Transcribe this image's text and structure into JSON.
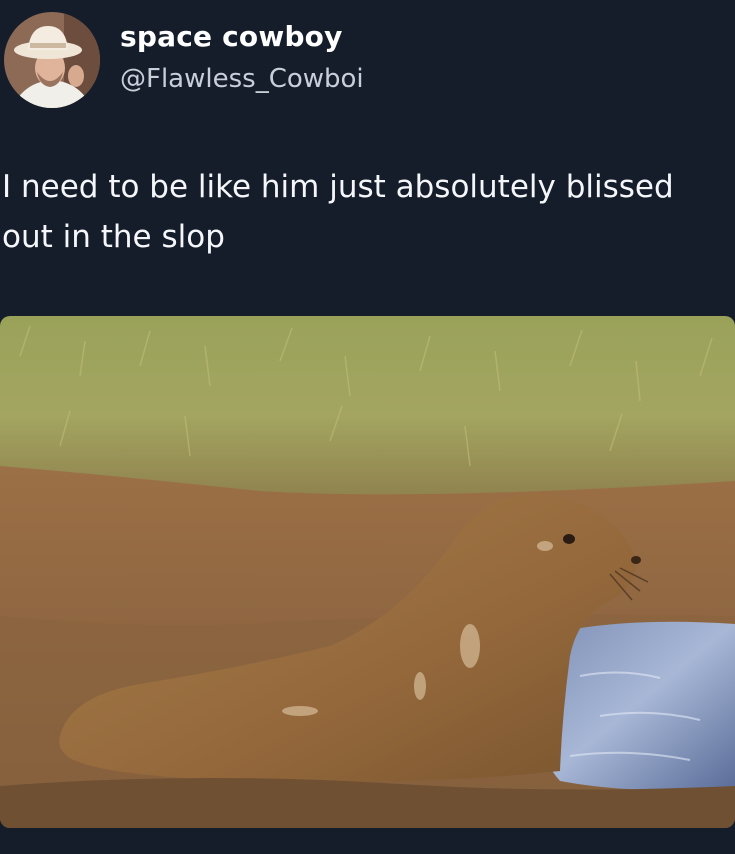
{
  "post": {
    "author": {
      "display_name": "space cowboy",
      "handle": "@Flawless_Cowboi",
      "avatar_icon": "profile-photo-cowboy-hat"
    },
    "text_lines": [
      "I need to be like him just absolutely blissed",
      "out in the slop"
    ],
    "media": {
      "description_icon": "photo-seal-in-mud"
    }
  },
  "colors": {
    "background": "#151d2b",
    "text": "#f4f6f9",
    "handle": "#c9cfd8"
  }
}
